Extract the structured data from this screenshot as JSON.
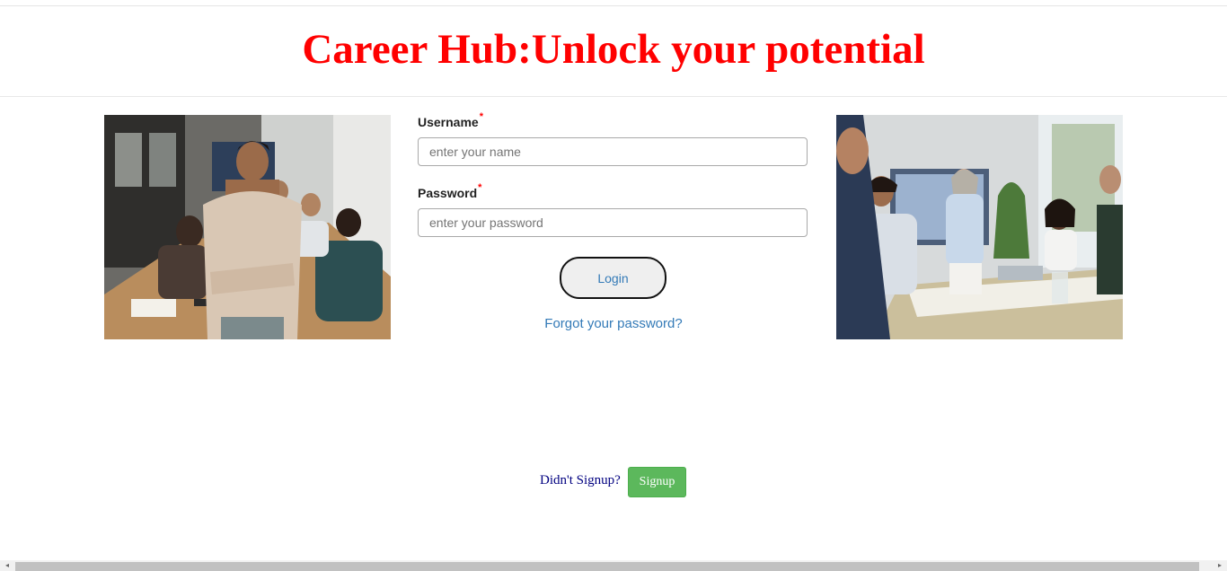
{
  "header": {
    "title": "Career Hub:Unlock your potential",
    "title_color": "#ff0000"
  },
  "images": {
    "left": {
      "icon": "team-meeting-photo"
    },
    "right": {
      "icon": "office-presentation-photo"
    }
  },
  "login_form": {
    "username_label": "Username",
    "username_required": "*",
    "username_placeholder": "enter your name",
    "password_label": "Password",
    "password_required": "*",
    "password_placeholder": "enter your password",
    "login_label": "Login",
    "forgot_label": "Forgot your password?"
  },
  "signup": {
    "prompt": "Didn't Signup?",
    "button_label": "Signup",
    "button_color": "#5cb85c"
  },
  "scrollbar": {
    "left_arrow": "◂",
    "right_arrow": "▸"
  }
}
